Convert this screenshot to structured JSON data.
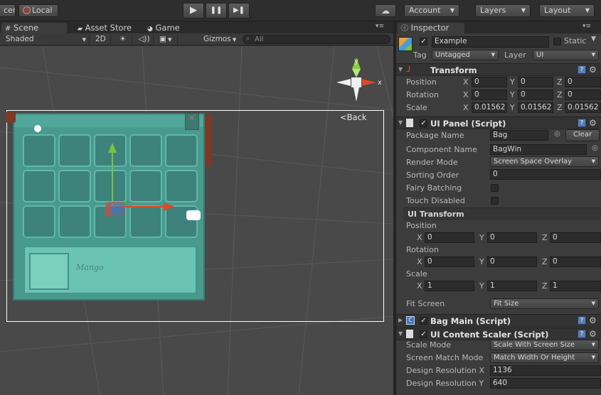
{
  "toolbar": {
    "left_partial": "cer",
    "local": "Local",
    "account": "Account",
    "layers": "Layers",
    "layout": "Layout",
    "play": "▶",
    "pause": "❚❚",
    "step": "▶❚"
  },
  "scene": {
    "tabs": [
      "Scene",
      "Asset Store",
      "Game"
    ],
    "shading": "Shaded",
    "mode_2d": "2D",
    "gizmos": "Gizmos",
    "search_placeholder": "All",
    "back_label": "Back",
    "bag_sprite_text": "Mango",
    "axis_labels": {
      "y": "y",
      "x": "x"
    }
  },
  "inspector": {
    "tab": "Inspector",
    "object_name": "Example",
    "static_label": "Static",
    "tag_label": "Tag",
    "tag_value": "Untagged",
    "layer_label": "Layer",
    "layer_value": "UI",
    "transform": {
      "title": "Transform",
      "rows": [
        {
          "label": "Position",
          "x": "0",
          "y": "0",
          "z": "0"
        },
        {
          "label": "Rotation",
          "x": "0",
          "y": "0",
          "z": "0"
        },
        {
          "label": "Scale",
          "x": "0.01562",
          "y": "0.01562",
          "z": "0.01562"
        }
      ]
    },
    "ui_panel": {
      "title": "UI Panel (Script)",
      "package_name_label": "Package Name",
      "package_name_value": "Bag",
      "clear_label": "Clear",
      "component_name_label": "Component Name",
      "component_name_value": "BagWin",
      "render_mode_label": "Render Mode",
      "render_mode_value": "Screen Space Overlay",
      "sorting_order_label": "Sorting Order",
      "sorting_order_value": "0",
      "fairy_batching_label": "Fairy Batching",
      "touch_disabled_label": "Touch Disabled",
      "ui_transform_label": "UI Transform",
      "position_label": "Position",
      "position": {
        "x": "0",
        "y": "0",
        "z": "0"
      },
      "rotation_label": "Rotation",
      "rotation": {
        "x": "0",
        "y": "0",
        "z": "0"
      },
      "scale_label": "Scale",
      "scale": {
        "x": "1",
        "y": "1",
        "z": "1"
      },
      "fit_screen_label": "Fit Screen",
      "fit_screen_value": "Fit Size"
    },
    "bag_main": {
      "title": "Bag Main (Script)"
    },
    "content_scaler": {
      "title": "UI Content Scaler (Script)",
      "scale_mode_label": "Scale Mode",
      "scale_mode_value": "Scale With Screen Size",
      "screen_match_label": "Screen Match Mode",
      "screen_match_value": "Match Width Or Height",
      "design_x_label": "Design Resolution X",
      "design_x_value": "1136",
      "design_y_label": "Design Resolution Y",
      "design_y_value": "640"
    }
  },
  "colors": {
    "toolbar_bg": "#2e2e2e",
    "scene_bg": "#494949",
    "inspector_bg": "#3c3c3c",
    "bag_frame": "#2a7a72",
    "bag_slot": "#1f5e5a",
    "bag_overlay": "#7fdcc8"
  }
}
